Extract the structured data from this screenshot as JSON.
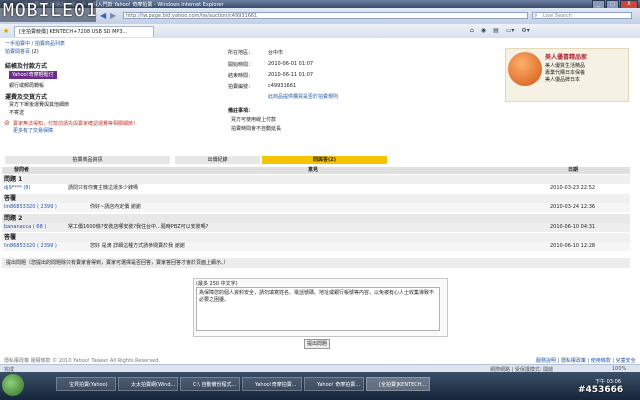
{
  "window": {
    "title": "[全拍賣競價]網路超全新一手 微瑕入門款 Yahoo! 奇摩拍賣 - Windows Internet Explorer",
    "brand": "MOBILE01",
    "controls": [
      "_",
      "□",
      "X"
    ]
  },
  "address_bar": {
    "value": "http://tw.page.bid.yahoo.com/tw/auction/c49931661"
  },
  "search_box": {
    "placeholder": "Live Search"
  },
  "tab": {
    "label": "[全拍賣競價] KENTECH+7208 USB SD MP3..."
  },
  "toolbar_icons": [
    "home-icon",
    "feeds-icon",
    "print-icon",
    "page-icon",
    "tools-icon"
  ],
  "top_link": "一手拍賣中 / 拍賣商品列表",
  "bid_history": {
    "label": "拍賣間答百",
    "count": "(2)"
  },
  "checkout_section": {
    "heading": "結帳及付款方式",
    "pay_button": "Yahoo!奇摩輕鬆付",
    "pay_note": "銀行或郵局轉帳"
  },
  "shipping_section": {
    "heading": "運費及交貨方式",
    "items": [
      "買方下單後運費與其他細節",
      "不寄送"
    ]
  },
  "note_section": {
    "text": "賣家無法得知，付款前請先與賣家確認運費等相關細節！",
    "link": "更多有了交易保障"
  },
  "details": {
    "rows": [
      {
        "label": "所在地區：",
        "value": "台中市"
      },
      {
        "label": "開始時間：",
        "value": "2010-06-01 01:07"
      },
      {
        "label": "結束時間：",
        "value": "2010-06-11 01:07"
      },
      {
        "label": "拍賣編號：",
        "value": "c49931661"
      }
    ],
    "link": "此商品提供購買是否於拍賣規則"
  },
  "notes_right": {
    "heading": "備註事項：",
    "items": [
      "買方可使用線上付款",
      "拍賣時間會不自動延長"
    ]
  },
  "ad": {
    "title": "美人優喜精品家",
    "lines": [
      "美人優質生活精品",
      "專業代購日本保養",
      "美人優品牌日本"
    ]
  },
  "tabs": [
    {
      "label": "拍賣商品資訊"
    },
    {
      "label": "出價紀錄"
    },
    {
      "label": "問與答(2)"
    }
  ],
  "qa": {
    "header": {
      "user": "發問者",
      "content": "意見",
      "date": "日期"
    },
    "entries": [
      {
        "q_label": "問題 1",
        "q_user": "dj9**** (8)",
        "q_text": "請問只有你實主機這運多少錢嗎",
        "q_date": "2010-03-23 22:52",
        "a_label": "答覆",
        "a_user": "lin86853320 ( 2399 )",
        "a_text": "你好~請店內定價 謝謝",
        "a_date": "2010-03-24 12:36"
      },
      {
        "q_label": "問題 2",
        "q_user": "bananacca ( 68 )",
        "q_text": "常工價1600條?安裝店哪安裝?我住台中...隨時PBZ可以安裝嗎?",
        "q_date": "2010-06-10 04:31",
        "a_label": "答覆",
        "a_user": "lin86853320 ( 2399 )",
        "a_text": "您好 是滴 詳細這種方式請參閱賣於我 謝謝",
        "a_date": "2010-06-10 12:28"
      }
    ]
  },
  "ask_bar": "提出問題（您提出的問題除只有賣家會得到，賣家可選擇是否回答，賣家答回答才會於頁面上顯示。）",
  "form": {
    "hint": "(最多 250 中文字)",
    "placeholder": "為保障您的個人資料安全，請勿填寫姓名、電話號碼、地址或銀行帳號等內容，以免被有心人士收集導致不必要之困擾。",
    "submit": "提出問題"
  },
  "footer": {
    "left": "隱私權政策  服權條款 © 2010 Yahoo! Taiwan All Rights Reserved.",
    "right": "服務說明 | 隱私權政策 | 使用條款 | 兒童安全"
  },
  "status": {
    "left": "完成",
    "right": "網際網路 | 受保護模式: 開啟",
    "zoom": "100%"
  },
  "taskbar": {
    "items": [
      "宝貝拍賣(Yahoo)",
      "太太拍賣網(Wind...",
      "C:\\ 自動備份程式...",
      "Yahoo!奇摩拍賣...",
      "Yahoo! 奇摩拍賣...",
      "[全拍賣]KENTECH..."
    ],
    "clock": "下午 03:06",
    "watermark": "#453666"
  }
}
